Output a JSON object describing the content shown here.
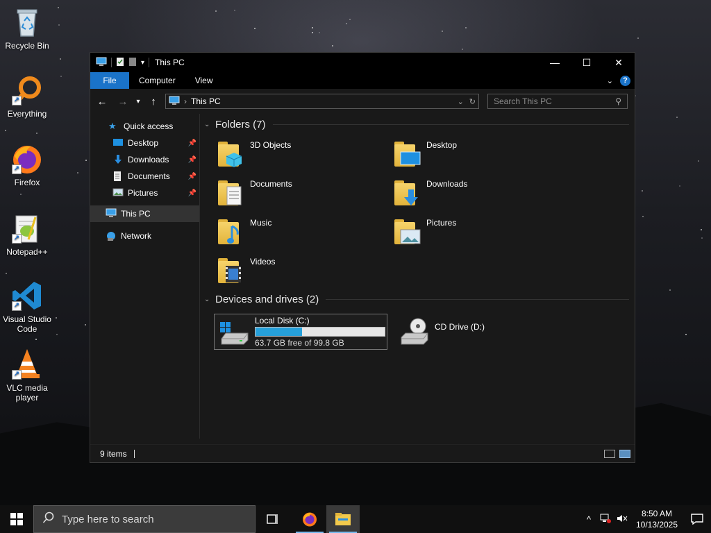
{
  "desktop": {
    "icons": [
      {
        "label": "Recycle Bin",
        "icon": "recycle-bin-icon"
      },
      {
        "label": "Everything",
        "icon": "everything-search-icon"
      },
      {
        "label": "Firefox",
        "icon": "firefox-icon"
      },
      {
        "label": "Notepad++",
        "icon": "notepad-plus-plus-icon"
      },
      {
        "label": "Visual Studio Code",
        "icon": "vscode-icon"
      },
      {
        "label": "VLC media player",
        "icon": "vlc-icon"
      }
    ]
  },
  "window": {
    "title": "This PC",
    "controls": {
      "minimize": "—",
      "maximize": "☐",
      "close": "✕"
    },
    "ribbon": {
      "tabs": [
        "File",
        "Computer",
        "View"
      ],
      "help": "?"
    },
    "address": {
      "path": "This PC",
      "separator": "›"
    },
    "search": {
      "placeholder": "Search This PC"
    },
    "sidebar": {
      "quick_access": "Quick access",
      "pinned": [
        "Desktop",
        "Downloads",
        "Documents",
        "Pictures"
      ],
      "this_pc": "This PC",
      "network": "Network"
    },
    "folders_header": "Folders (7)",
    "folders": [
      "3D Objects",
      "Desktop",
      "Documents",
      "Downloads",
      "Music",
      "Pictures",
      "Videos"
    ],
    "devices_header": "Devices and drives (2)",
    "drives": [
      {
        "name": "Local Disk (C:)",
        "free_text": "63.7 GB free of 99.8 GB",
        "used_fraction": 0.362
      },
      {
        "name": "CD Drive (D:)"
      }
    ],
    "status": {
      "items": "9 items"
    }
  },
  "taskbar": {
    "search_placeholder": "Type here to search",
    "time": "8:50 AM",
    "date": "10/13/2025"
  },
  "colors": {
    "accent": "#1a73c9",
    "drive_fill": "#26a0da",
    "folder": "#e2b33b"
  }
}
